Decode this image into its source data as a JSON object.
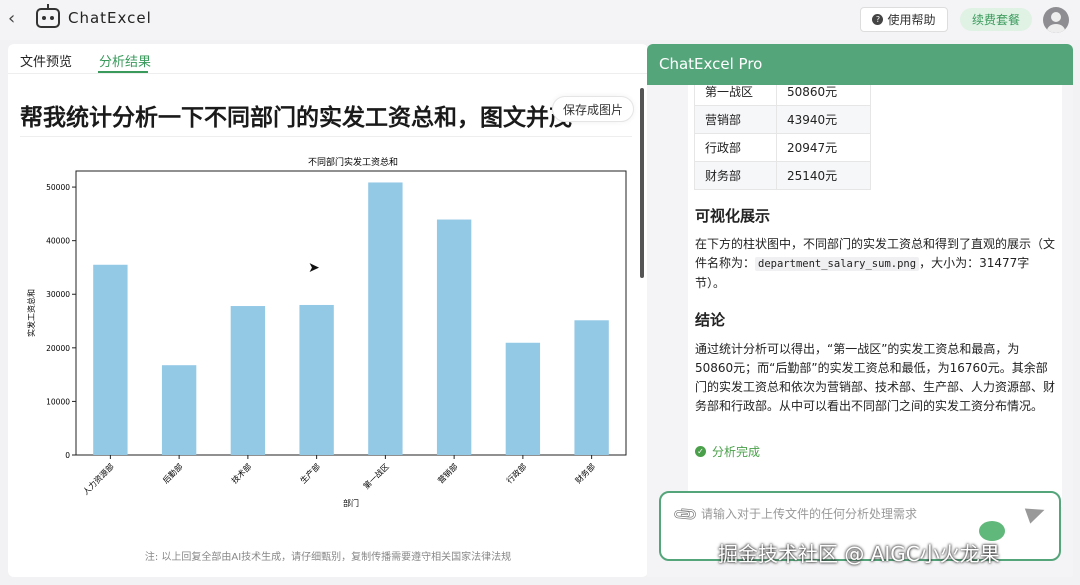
{
  "topbar": {
    "brand": "ChatExcel",
    "help_label": "使用帮助",
    "renew_label": "续费套餐"
  },
  "tabs": [
    {
      "label": "文件预览",
      "active": false
    },
    {
      "label": "分析结果",
      "active": true
    }
  ],
  "left": {
    "question": "帮我统计分析一下不同部门的实发工资总和，图文并茂",
    "save_label": "保存成图片",
    "note": "注: 以上回复全部由AI技术生成，请仔细甄别，复制传播需要遵守相关国家法律法规"
  },
  "chart_data": {
    "type": "bar",
    "title": "不同部门实发工资总和",
    "xlabel": "部门",
    "ylabel": "实发工资总和",
    "categories": [
      "人力资源部",
      "后勤部",
      "技术部",
      "生产部",
      "第一战区",
      "营销部",
      "行政部",
      "财务部"
    ],
    "values": [
      35500,
      16760,
      27800,
      28000,
      50860,
      43940,
      20947,
      25140
    ],
    "ylim": [
      0,
      53000
    ],
    "yticks": [
      0,
      10000,
      20000,
      30000,
      40000,
      50000
    ],
    "bar_color": "#94c9e6",
    "grid": false
  },
  "right": {
    "title": "ChatExcel Pro",
    "table": [
      [
        "第一战区",
        "50860元"
      ],
      [
        "营销部",
        "43940元"
      ],
      [
        "行政部",
        "20947元"
      ],
      [
        "财务部",
        "25140元"
      ]
    ],
    "vis_heading": "可视化展示",
    "vis_text_a": "在下方的柱状图中，不同部门的实发工资总和得到了直观的展示（文件名称为：",
    "vis_code": "department_salary_sum.png",
    "vis_text_b": "，大小为：31477字节）。",
    "con_heading": "结论",
    "con_text": "通过统计分析可以得出，“第一战区”的实发工资总和最高，为50860元；而“后勤部”的实发工资总和最低，为16760元。其余部门的实发工资总和依次为营销部、技术部、生产部、人力资源部、财务部和行政部。从中可以看出不同部门之间的实发工资分布情况。",
    "done_label": "分析完成",
    "input_placeholder": "请输入对于上传文件的任何分析处理需求"
  },
  "watermark": "掘金技术社区 @ AIGC小火龙果",
  "colors": {
    "accent": "#55a57b",
    "bar": "#94c9e6"
  }
}
